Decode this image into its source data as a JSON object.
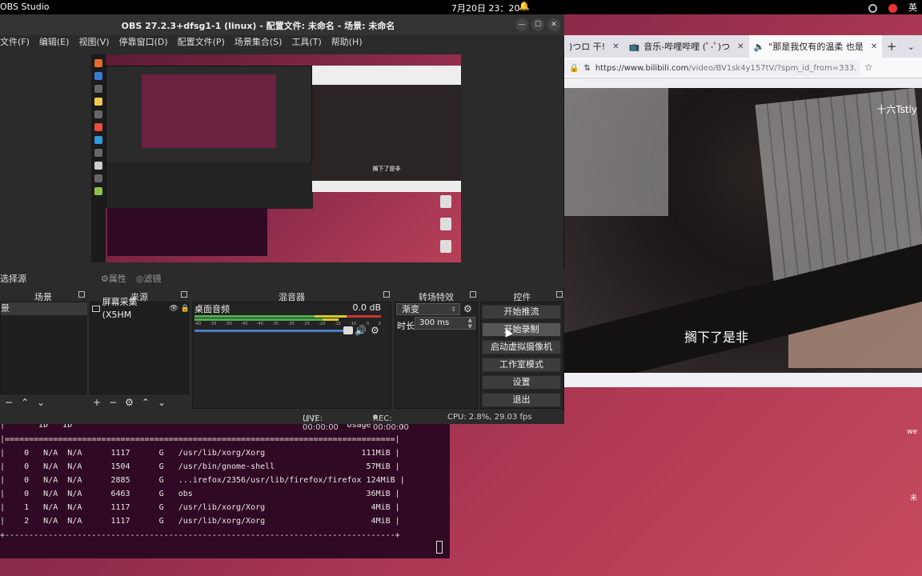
{
  "topbar": {
    "app_name": "OBS Studio",
    "clock": "7月20日 23：20",
    "input_method": "英"
  },
  "obs": {
    "title": "OBS 27.2.3+dfsg1-1 (linux) - 配置文件: 未命名 - 场景: 未命名",
    "menu": [
      "文件(F)",
      "编辑(E)",
      "视图(V)",
      "停靠窗口(D)",
      "配置文件(P)",
      "场景集合(S)",
      "工具(T)",
      "帮助(H)"
    ],
    "source_bar": {
      "label": "选择源",
      "properties": "属性",
      "filters": "滤镜"
    },
    "docks": {
      "scenes": "场景",
      "sources": "来源",
      "mixer": "混音器",
      "transitions": "转场特效",
      "controls": "控件"
    },
    "scenes": {
      "item": "景"
    },
    "sources": {
      "item": "屏幕采集 (X5HM"
    },
    "mixer": {
      "track_name": "桌面音频",
      "db": "0.0 dB",
      "ticks": [
        "-60",
        "-55",
        "-50",
        "-45",
        "-40",
        "-35",
        "-30",
        "-25",
        "-20",
        "-15",
        "-10",
        "-5",
        "0"
      ]
    },
    "transitions": {
      "selected": "渐变",
      "duration_label": "时长",
      "duration_value": "300 ms"
    },
    "controls": [
      "开始推流",
      "开始录制",
      "启动虚拟摄像机",
      "工作室模式",
      "设置",
      "退出"
    ],
    "status": {
      "live": "LIVE: 00:00:00",
      "rec": "REC: 00:00:00",
      "cpu": "CPU: 2.8%, 29.03 fps"
    },
    "preview_subtitle": "搁下了是非"
  },
  "browser": {
    "tabs": [
      {
        "label": ")つロ 干!"
      },
      {
        "label": "音乐-哔哩哔哩 (ﾟ-ﾟ)つ"
      },
      {
        "label": "\"那是我仅有的温柔 也是"
      }
    ],
    "url_host": "https://www.bilibili.com",
    "url_path": "/video/BV1sk4y157tV/?spm_id_from=333.",
    "video_watermark": "十六Tstly",
    "video_subtitle": "搁下了是非",
    "edge_text_1": "we",
    "edge_text_2": "未"
  },
  "terminal": {
    "header": "|       ID   ID                                                         Usage      |",
    "divider": "|=================================================================================|",
    "rows": [
      "|    0   N/A  N/A      1117      G   /usr/lib/xorg/Xorg                    111MiB |",
      "|    0   N/A  N/A      1504      G   /usr/bin/gnome-shell                   57MiB |",
      "|    0   N/A  N/A      2885      G   ...irefox/2356/usr/lib/firefox/firefox 124MiB |",
      "|    0   N/A  N/A      6463      G   obs                                    36MiB |",
      "|    1   N/A  N/A      1117      G   /usr/lib/xorg/Xorg                      4MiB |",
      "|    2   N/A  N/A      1117      G   /usr/lib/xorg/Xorg                      4MiB |"
    ],
    "footer": "+---------------------------------------------------------------------------------+"
  }
}
